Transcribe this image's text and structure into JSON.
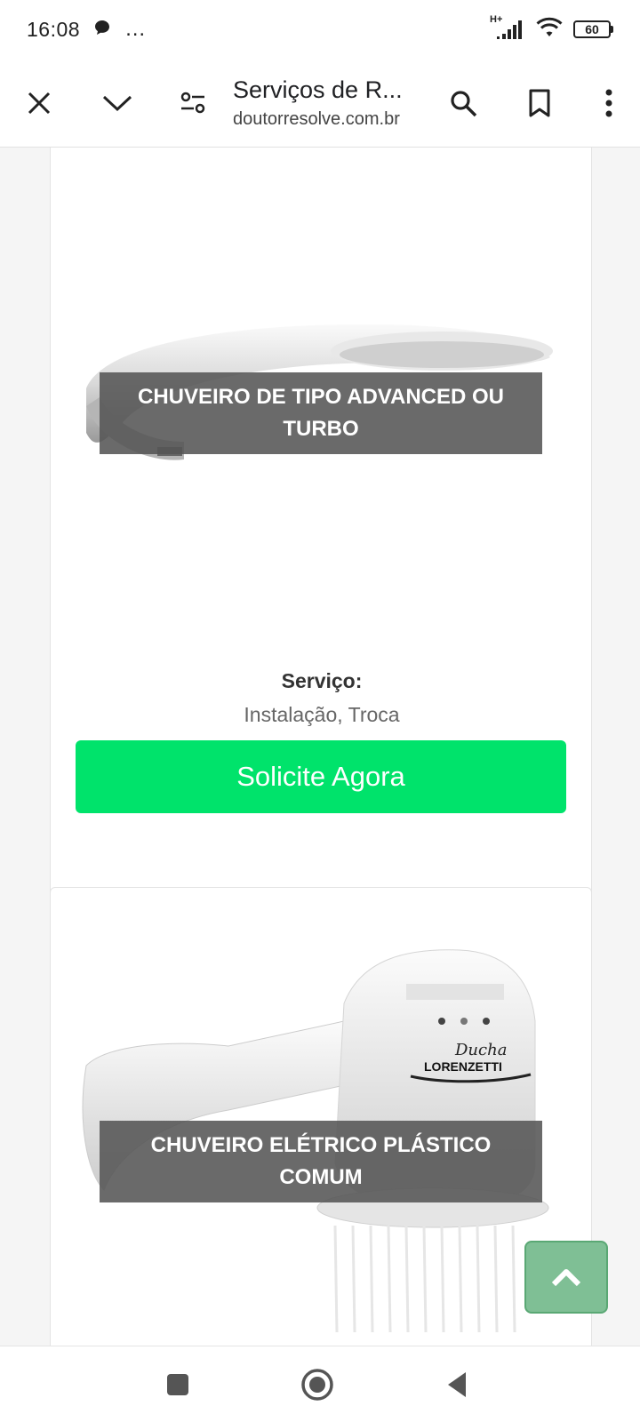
{
  "status_bar": {
    "time": "16:08",
    "overflow": "…",
    "network_type": "H+",
    "battery_level": "60",
    "icons": [
      "chat-bubble-icon",
      "signal-icon",
      "wifi-icon",
      "battery-icon"
    ]
  },
  "toolbar": {
    "page_title": "Serviços de R...",
    "page_url": "doutorresolve.com.br",
    "icons": [
      "close-icon",
      "chevron-down-icon",
      "page-settings-icon",
      "search-icon",
      "bookmark-icon",
      "more-vert-icon"
    ]
  },
  "cards": [
    {
      "title": "CHUVEIRO DE TIPO ADVANCED OU TURBO",
      "service_label": "Serviço:",
      "service_value": "Instalação, Troca",
      "cta_label": "Solicite Agora"
    },
    {
      "title": "CHUVEIRO ELÉTRICO PLÁSTICO COMUM",
      "brand_text": "LORENZETTI",
      "brand_script": "Ducha"
    }
  ],
  "scroll_top": {
    "icon": "chevron-up-icon"
  },
  "nav_bar": {
    "icons": [
      "recents-icon",
      "home-icon",
      "back-icon"
    ]
  },
  "colors": {
    "cta": "#00e36b",
    "scroll_top": "#7fbf95",
    "overlay": "#555555"
  }
}
